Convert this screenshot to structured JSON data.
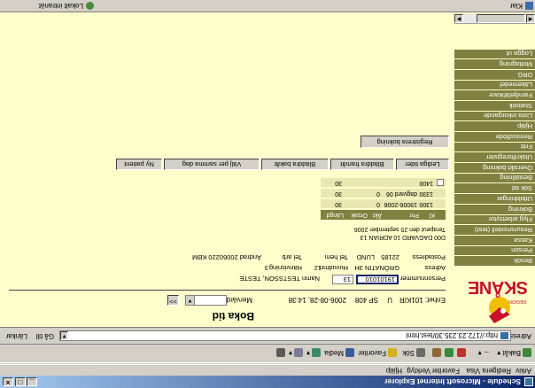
{
  "window": {
    "title": "Schedule - Microsoft Internet Explorer",
    "min": "_",
    "max": "□",
    "close": "×"
  },
  "menu": [
    "Arkiv",
    "Redigera",
    "Visa",
    "Favoriter",
    "Verktyg",
    "Hjälp"
  ],
  "toolbar": {
    "back": "Bakåt",
    "search": "Sök",
    "favorites": "Favoriter",
    "media": "Media"
  },
  "address": {
    "label": "Adress",
    "url": "http://172.23.235.30/test.html",
    "go": "Gå till",
    "links": "Länkar"
  },
  "logo": {
    "text": "SKÅNE",
    "sub": "REGION"
  },
  "nav": [
    "Besök",
    "Person",
    "Kassa",
    "Resursmodell (test)",
    "Flyg arbetsytor",
    "Bokning",
    "Utbildningar",
    "Sök tid",
    "Beställning",
    "Översikt bokning",
    "Utskriftsregister",
    "Fritt",
    "Remissflöde",
    "Hjälp",
    "Lista inkorgande",
    "Statistik",
    "Familjelähkare",
    "Läkemedel",
    "DRG",
    "Mottagning",
    "Logga ut"
  ],
  "main": {
    "title": "Boka tid",
    "enhet": "Enhet: 101KIR",
    "u": "U",
    "sp": "SP 408",
    "datetime": "2006-08-28, 14:38",
    "mervard_label": "Mervärd",
    "select_btn": ">>",
    "pnr_label": "Personnummer",
    "pnr_value": "19101010",
    "pnr_suffix": "13",
    "namn_label": "Namn",
    "namn_value": "TESTSSON, TESTE",
    "adress_label": "Adress",
    "adress_value": "GRÖNATIN 3H",
    "nivad_label": "Huvudmn",
    "nivad_value": "12",
    "hadinfo_label": "Hänvisning",
    "hadinfo_value": "3",
    "postadress_label": "Postadress",
    "postadress_value": "22185",
    "ort": "LUND",
    "tel_label": "Tel hem",
    "telarb_label": "Tel arb",
    "andrad": "Ändrad 20060220 KBM"
  },
  "calendar": {
    "caption1": "D00 DAGVARD 10 ADRIAN 13",
    "caption2": "Terapeut den 25 september 2006",
    "headers": [
      "Kl",
      "Pnr",
      "Åkt",
      "Orsak",
      "Längd"
    ],
    "rows": [
      {
        "kl": "1300",
        "pnr": "19006-2006",
        "akt": "0",
        "orsak": "",
        "langd": "30"
      },
      {
        "kl": "1330",
        "pnr": "dagvard 06",
        "akt": "0",
        "orsak": "",
        "langd": "30"
      },
      {
        "kl": "1400",
        "pnr": "",
        "akt": "",
        "orsak": "",
        "langd": "30"
      }
    ]
  },
  "tabs": [
    "Lediga tider",
    "Bläddra framåt",
    "Bläddra bakåt",
    "Välj per samma dag",
    "Ny patient"
  ],
  "register_button": "Registrera bokning",
  "status": {
    "left": "Klar",
    "right": "Lokalt intranät"
  }
}
